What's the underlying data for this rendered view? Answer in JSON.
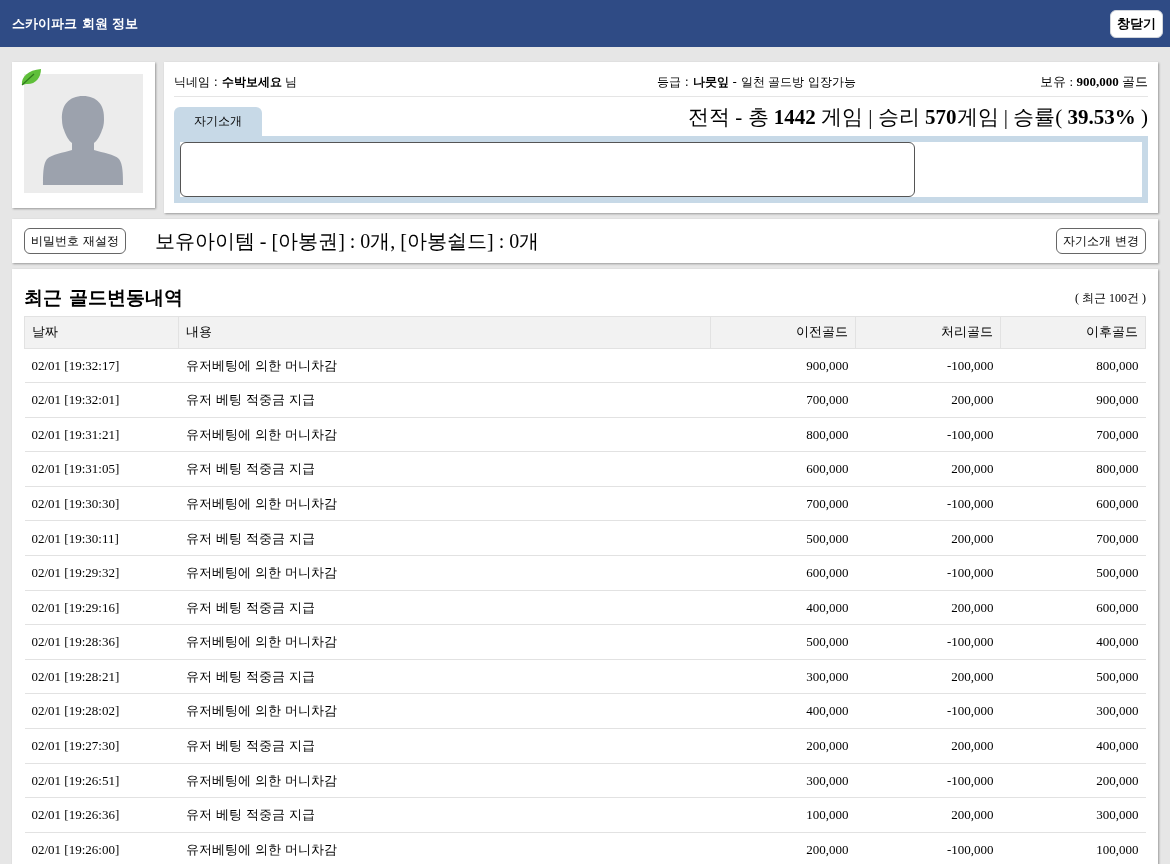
{
  "header": {
    "title": "스카이파크 회원 정보",
    "close_button": "창닫기"
  },
  "profile": {
    "nickname": "닉네임 : **수박보세요** 님",
    "grade": "등급 : **나뭇잎** - 일천 골드방 입장가능",
    "gold": "보유 : **900,000** 골드",
    "record": "전적 - 총 **1442** 게임 | 승리 **570**게임 | 승률( **39.53%** )",
    "tabs": [
      {
        "label": "자기소개",
        "selected": true
      }
    ]
  },
  "items_bar": {
    "password_button": "비밀번호 재설정",
    "items_text": "보유아이템 - [아봉권] : 0개, [아봉쉴드] : 0개",
    "intro_button": "자기소개 변경"
  },
  "history": {
    "title": "최근 골드변동내역",
    "note": "( 최근 100건 )",
    "columns": [
      "날짜",
      "내용",
      "이전골드",
      "처리골드",
      "이후골드"
    ],
    "rows": [
      [
        "02/01 [19:32:17]",
        "유저베팅에 의한 머니차감",
        "900,000",
        "-100,000",
        "800,000"
      ],
      [
        "02/01 [19:32:01]",
        "유저 베팅 적중금 지급",
        "700,000",
        "200,000",
        "900,000"
      ],
      [
        "02/01 [19:31:21]",
        "유저베팅에 의한 머니차감",
        "800,000",
        "-100,000",
        "700,000"
      ],
      [
        "02/01 [19:31:05]",
        "유저 베팅 적중금 지급",
        "600,000",
        "200,000",
        "800,000"
      ],
      [
        "02/01 [19:30:30]",
        "유저베팅에 의한 머니차감",
        "700,000",
        "-100,000",
        "600,000"
      ],
      [
        "02/01 [19:30:11]",
        "유저 베팅 적중금 지급",
        "500,000",
        "200,000",
        "700,000"
      ],
      [
        "02/01 [19:29:32]",
        "유저베팅에 의한 머니차감",
        "600,000",
        "-100,000",
        "500,000"
      ],
      [
        "02/01 [19:29:16]",
        "유저 베팅 적중금 지급",
        "400,000",
        "200,000",
        "600,000"
      ],
      [
        "02/01 [19:28:36]",
        "유저베팅에 의한 머니차감",
        "500,000",
        "-100,000",
        "400,000"
      ],
      [
        "02/01 [19:28:21]",
        "유저 베팅 적중금 지급",
        "300,000",
        "200,000",
        "500,000"
      ],
      [
        "02/01 [19:28:02]",
        "유저베팅에 의한 머니차감",
        "400,000",
        "-100,000",
        "300,000"
      ],
      [
        "02/01 [19:27:30]",
        "유저 베팅 적중금 지급",
        "200,000",
        "200,000",
        "400,000"
      ],
      [
        "02/01 [19:26:51]",
        "유저베팅에 의한 머니차감",
        "300,000",
        "-100,000",
        "200,000"
      ],
      [
        "02/01 [19:26:36]",
        "유저 베팅 적중금 지급",
        "100,000",
        "200,000",
        "300,000"
      ],
      [
        "02/01 [19:26:00]",
        "유저베팅에 의한 머니차감",
        "200,000",
        "-100,000",
        "100,000"
      ]
    ]
  }
}
